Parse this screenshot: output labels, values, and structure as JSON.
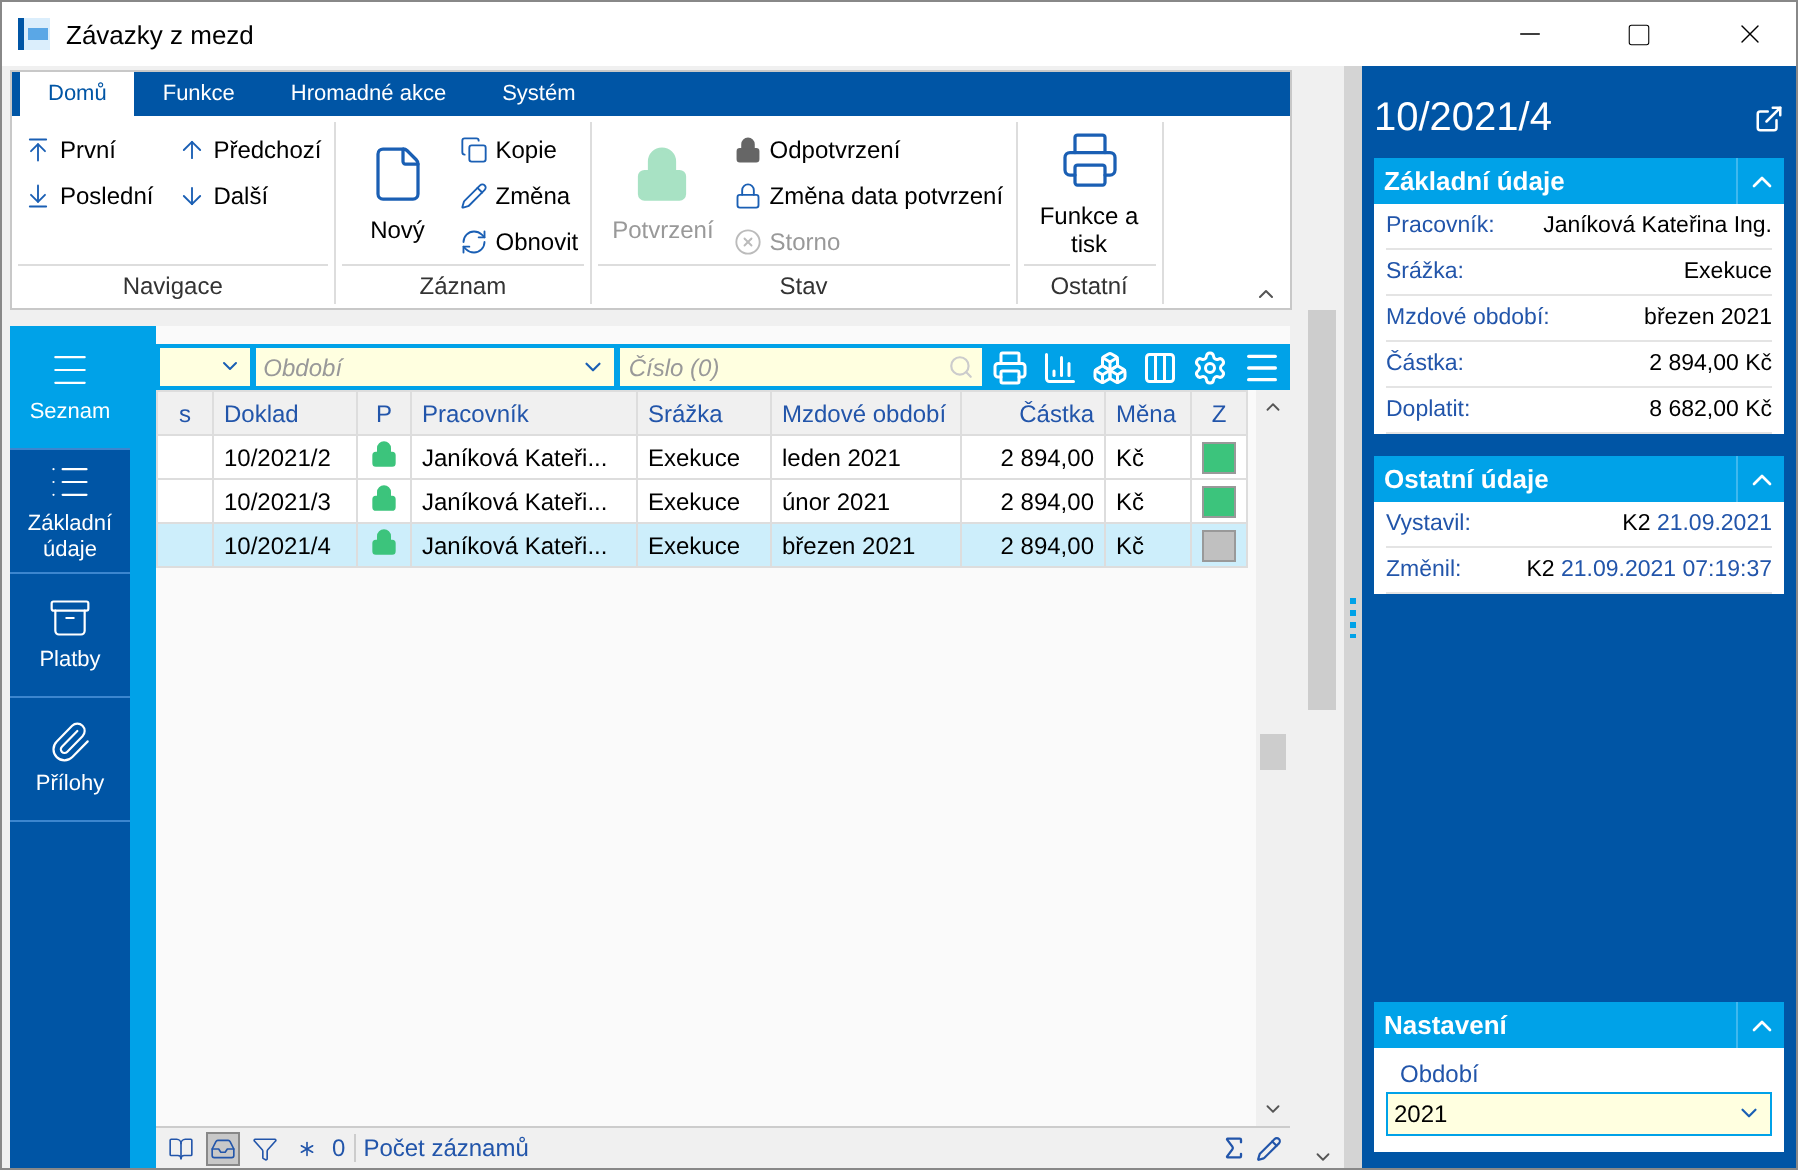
{
  "window": {
    "title": "Závazky z mezd"
  },
  "ribbon": {
    "tabs": [
      {
        "label": "Domů",
        "selected": true
      },
      {
        "label": "Funkce",
        "selected": false
      },
      {
        "label": "Hromadné akce",
        "selected": false
      },
      {
        "label": "Systém",
        "selected": false
      }
    ],
    "groups": [
      {
        "title": "Navigace",
        "items": [
          {
            "label": "První",
            "kind": "small",
            "disabled": false
          },
          {
            "label": "Poslední",
            "kind": "small",
            "disabled": false
          },
          {
            "label": "Předchozí",
            "kind": "small",
            "disabled": false
          },
          {
            "label": "Další",
            "kind": "small",
            "disabled": false
          }
        ]
      },
      {
        "title": "Záznam",
        "items": [
          {
            "label": "Nový",
            "kind": "large",
            "disabled": false
          },
          {
            "label": "Kopie",
            "kind": "small",
            "disabled": false
          },
          {
            "label": "Změna",
            "kind": "small",
            "disabled": false
          },
          {
            "label": "Obnovit",
            "kind": "small",
            "disabled": false
          }
        ]
      },
      {
        "title": "Stav",
        "items": [
          {
            "label": "Potvrzení",
            "kind": "large",
            "disabled": true
          },
          {
            "label": "Odpotvrzení",
            "kind": "small",
            "disabled": false
          },
          {
            "label": "Změna data potvrzení",
            "kind": "small",
            "disabled": false
          },
          {
            "label": "Storno",
            "kind": "small",
            "disabled": true
          }
        ]
      },
      {
        "title": "Ostatní",
        "items": [
          {
            "label": "Funkce a tisk",
            "kind": "large",
            "disabled": false
          }
        ]
      }
    ]
  },
  "side_nav": [
    {
      "label": "Seznam",
      "selected": true
    },
    {
      "label": "Základní údaje",
      "selected": false
    },
    {
      "label": "Platby",
      "selected": false
    },
    {
      "label": "Přílohy",
      "selected": false
    }
  ],
  "filters": [
    {
      "placeholder": "Období",
      "kind": "dropdown"
    },
    {
      "placeholder": "Číslo (0)",
      "kind": "search"
    }
  ],
  "table": {
    "columns": [
      "s",
      "Doklad",
      "P",
      "Pracovník",
      "Srážka",
      "Mzdové období",
      "Částka",
      "Měna",
      "Z"
    ],
    "rows": [
      {
        "doklad": "10/2021/2",
        "confirmed": true,
        "pracovnik": "Janíková Kateři...",
        "srazka": "Exekuce",
        "obdobi": "leden 2021",
        "castka": "2 894,00",
        "mena": "Kč",
        "color": "#3cc47c",
        "selected": false
      },
      {
        "doklad": "10/2021/3",
        "confirmed": true,
        "pracovnik": "Janíková Kateři...",
        "srazka": "Exekuce",
        "obdobi": "únor 2021",
        "castka": "2 894,00",
        "mena": "Kč",
        "color": "#3cc47c",
        "selected": false
      },
      {
        "doklad": "10/2021/4",
        "confirmed": true,
        "pracovnik": "Janíková Kateři...",
        "srazka": "Exekuce",
        "obdobi": "březen 2021",
        "castka": "2 894,00",
        "mena": "Kč",
        "color": "#c0c0c0",
        "selected": true
      }
    ]
  },
  "status_bar": {
    "tools": [
      {
        "selected": false
      },
      {
        "selected": true
      },
      {
        "selected": false
      },
      {
        "selected": false
      }
    ],
    "count": "0",
    "label": "Počet záznamů"
  },
  "detail": {
    "title": "10/2021/4",
    "sections": [
      {
        "title": "Základní údaje",
        "expanded": true,
        "fields": [
          {
            "label": "Pracovník:",
            "value": "Janíková Kateřina Ing."
          },
          {
            "label": "Srážka:",
            "value": "Exekuce"
          },
          {
            "label": "Mzdové období:",
            "value": "březen 2021"
          },
          {
            "label": "Částka:",
            "value": "2 894,00 Kč"
          },
          {
            "label": "Doplatit:",
            "value": "8 682,00 Kč"
          }
        ]
      },
      {
        "title": "Ostatní údaje",
        "expanded": true,
        "fields": [
          {
            "label": "Vystavil:",
            "user": "K2",
            "date": "21.09.2021"
          },
          {
            "label": "Změnil:",
            "user": "K2",
            "date": "21.09.2021 07:19:37"
          }
        ]
      }
    ],
    "settings": {
      "title": "Nastavení",
      "expanded": true,
      "label": "Období",
      "value": "2021"
    }
  }
}
